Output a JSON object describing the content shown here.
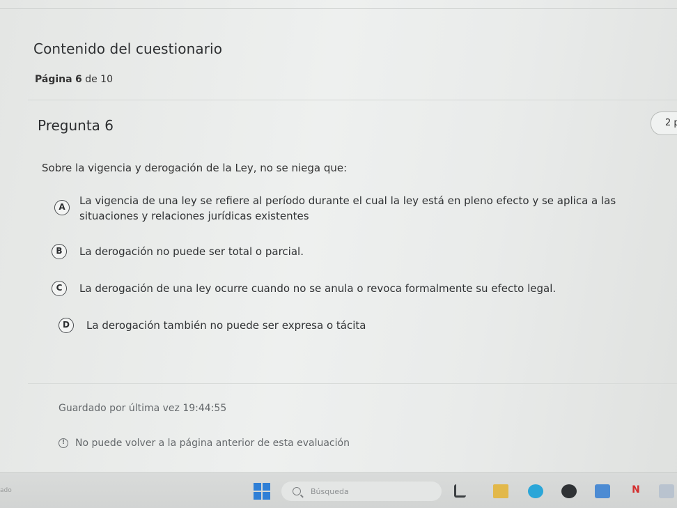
{
  "quiz": {
    "title": "Contenido del cuestionario",
    "page_label": "Página",
    "page_current": "6",
    "page_of": "de 10"
  },
  "question": {
    "title": "Pregunta 6",
    "points": "2 p",
    "text": "Sobre la vigencia y derogación de la Ley, no se niega que:",
    "options": [
      {
        "letter": "A",
        "text": "La vigencia de una ley se refiere al período durante el cual la ley está en pleno efecto y se aplica a las situaciones y relaciones jurídicas existentes"
      },
      {
        "letter": "B",
        "text": "La derogación no puede ser total o parcial."
      },
      {
        "letter": "C",
        "text": "La derogación de una ley ocurre cuando no se anula o revoca formalmente su efecto legal."
      },
      {
        "letter": "D",
        "text": "La derogación también no puede ser expresa o tácita"
      }
    ]
  },
  "footer": {
    "saved_status": "Guardado por última vez 19:44:55",
    "notice": "No puede volver a la página anterior de esta evaluación"
  },
  "taskbar": {
    "left_text": "ado",
    "search_placeholder": "Búsqueda",
    "app_6_label": "N"
  },
  "colors": {
    "accent_start": "#2f7fd6"
  }
}
